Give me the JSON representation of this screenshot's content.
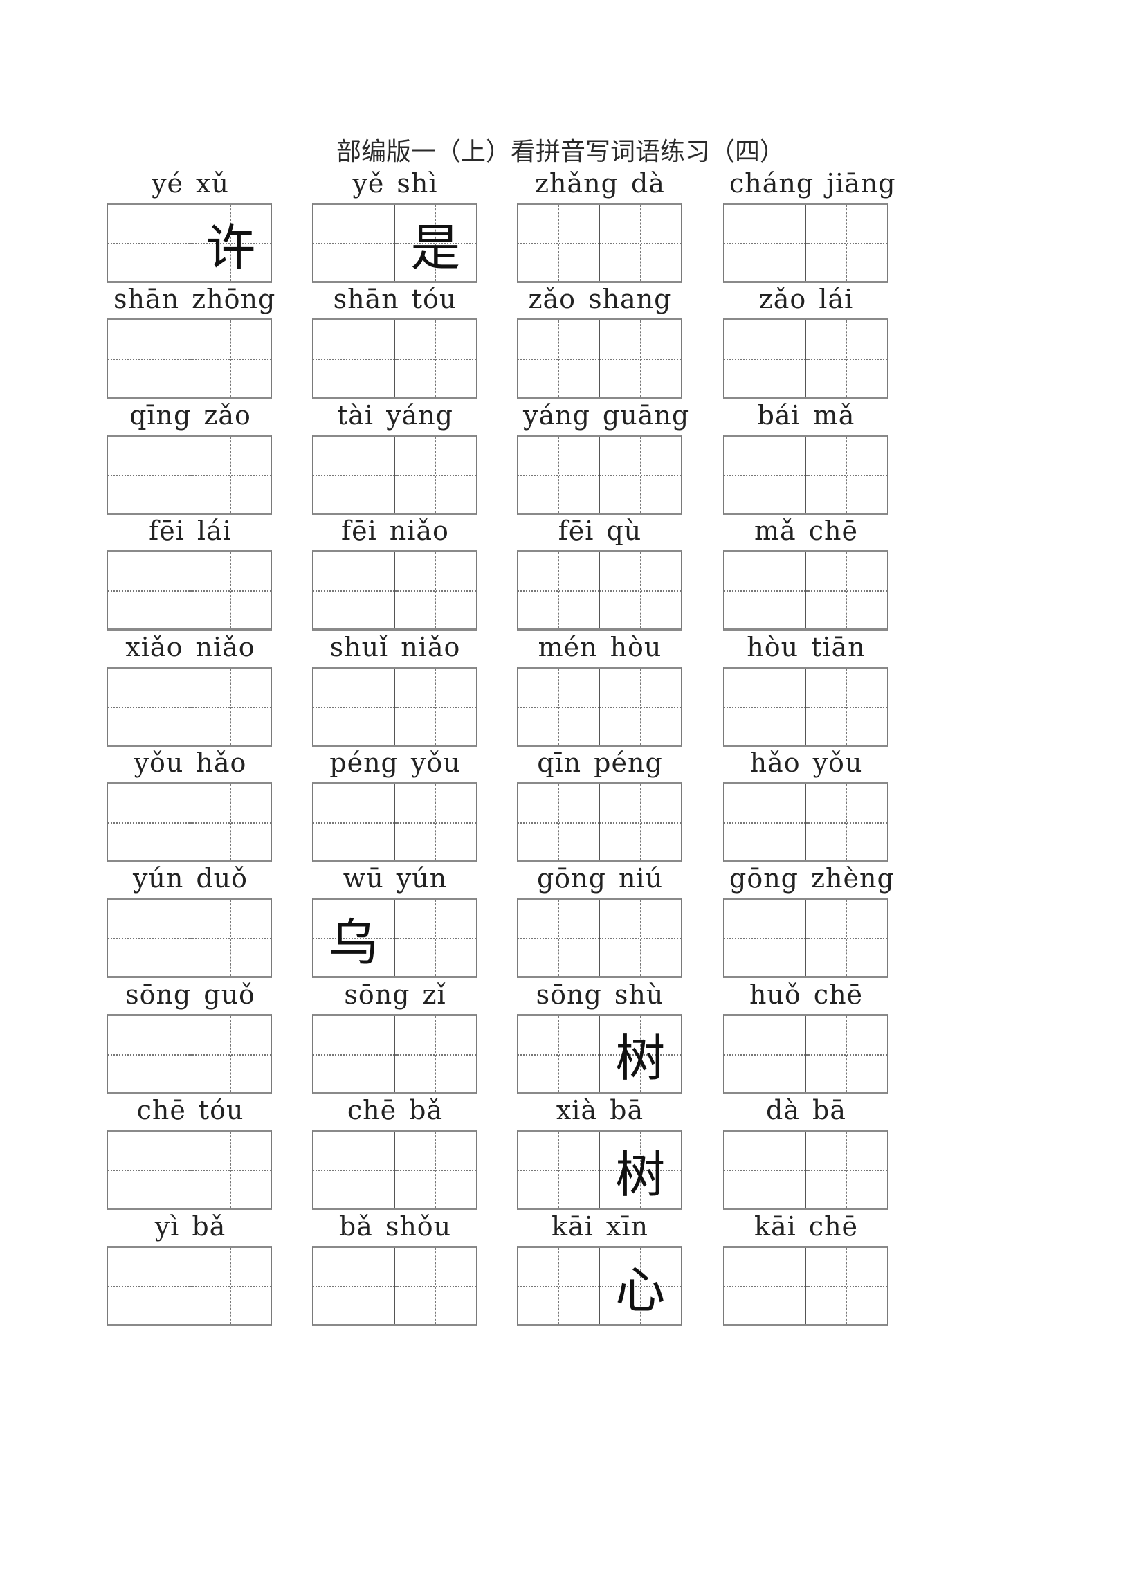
{
  "title": "部编版一（上）看拼音写词语练习（四）",
  "rows": [
    [
      {
        "pinyin": [
          "yé",
          "xǔ"
        ],
        "chars": [
          "",
          "许"
        ]
      },
      {
        "pinyin": [
          "yě",
          "shì"
        ],
        "chars": [
          "",
          "是"
        ]
      },
      {
        "pinyin": [
          "zhǎng",
          "dà"
        ],
        "chars": [
          "",
          ""
        ]
      },
      {
        "pinyin": [
          "cháng",
          "jiāng"
        ],
        "chars": [
          "",
          ""
        ]
      }
    ],
    [
      {
        "pinyin": [
          "shān",
          "zhōng"
        ],
        "chars": [
          "",
          ""
        ]
      },
      {
        "pinyin": [
          "shān",
          "tóu"
        ],
        "chars": [
          "",
          ""
        ]
      },
      {
        "pinyin": [
          "zǎo",
          "shang"
        ],
        "chars": [
          "",
          ""
        ]
      },
      {
        "pinyin": [
          "zǎo",
          "lái"
        ],
        "chars": [
          "",
          ""
        ]
      }
    ],
    [
      {
        "pinyin": [
          "qīng",
          "zǎo"
        ],
        "chars": [
          "",
          ""
        ]
      },
      {
        "pinyin": [
          "tài",
          "yáng"
        ],
        "chars": [
          "",
          ""
        ]
      },
      {
        "pinyin": [
          "yáng",
          "guāng"
        ],
        "chars": [
          "",
          ""
        ]
      },
      {
        "pinyin": [
          "bái",
          "mǎ"
        ],
        "chars": [
          "",
          ""
        ]
      }
    ],
    [
      {
        "pinyin": [
          "fēi",
          "lái"
        ],
        "chars": [
          "",
          ""
        ]
      },
      {
        "pinyin": [
          "fēi",
          "niǎo"
        ],
        "chars": [
          "",
          ""
        ]
      },
      {
        "pinyin": [
          "fēi",
          "qù"
        ],
        "chars": [
          "",
          ""
        ]
      },
      {
        "pinyin": [
          "mǎ",
          "chē"
        ],
        "chars": [
          "",
          ""
        ]
      }
    ],
    [
      {
        "pinyin": [
          "xiǎo",
          "niǎo"
        ],
        "chars": [
          "",
          ""
        ]
      },
      {
        "pinyin": [
          "shuǐ",
          "niǎo"
        ],
        "chars": [
          "",
          ""
        ]
      },
      {
        "pinyin": [
          "mén",
          "hòu"
        ],
        "chars": [
          "",
          ""
        ]
      },
      {
        "pinyin": [
          "hòu",
          "tiān"
        ],
        "chars": [
          "",
          ""
        ]
      }
    ],
    [
      {
        "pinyin": [
          "yǒu",
          "hǎo"
        ],
        "chars": [
          "",
          ""
        ]
      },
      {
        "pinyin": [
          "péng",
          "yǒu"
        ],
        "chars": [
          "",
          ""
        ]
      },
      {
        "pinyin": [
          "qīn",
          "péng"
        ],
        "chars": [
          "",
          ""
        ]
      },
      {
        "pinyin": [
          "hǎo",
          "yǒu"
        ],
        "chars": [
          "",
          ""
        ]
      }
    ],
    [
      {
        "pinyin": [
          "yún",
          "duǒ"
        ],
        "chars": [
          "",
          ""
        ]
      },
      {
        "pinyin": [
          "wū",
          "yún"
        ],
        "chars": [
          "乌",
          ""
        ]
      },
      {
        "pinyin": [
          "gōng",
          "niú"
        ],
        "chars": [
          "",
          ""
        ]
      },
      {
        "pinyin": [
          "gōng",
          "zhèng"
        ],
        "chars": [
          "",
          ""
        ]
      }
    ],
    [
      {
        "pinyin": [
          "sōng",
          "guǒ"
        ],
        "chars": [
          "",
          ""
        ]
      },
      {
        "pinyin": [
          "sōng",
          "zǐ"
        ],
        "chars": [
          "",
          ""
        ]
      },
      {
        "pinyin": [
          "sōng",
          "shù"
        ],
        "chars": [
          "",
          "树"
        ]
      },
      {
        "pinyin": [
          "huǒ",
          "chē"
        ],
        "chars": [
          "",
          ""
        ]
      }
    ],
    [
      {
        "pinyin": [
          "chē",
          "tóu"
        ],
        "chars": [
          "",
          ""
        ]
      },
      {
        "pinyin": [
          "chē",
          "bǎ"
        ],
        "chars": [
          "",
          ""
        ]
      },
      {
        "pinyin": [
          "xià",
          "bā"
        ],
        "chars": [
          "",
          "树"
        ]
      },
      {
        "pinyin": [
          "dà",
          "bā"
        ],
        "chars": [
          "",
          ""
        ]
      }
    ],
    [
      {
        "pinyin": [
          "yì",
          "bǎ"
        ],
        "chars": [
          "",
          ""
        ]
      },
      {
        "pinyin": [
          "bǎ",
          "shǒu"
        ],
        "chars": [
          "",
          ""
        ]
      },
      {
        "pinyin": [
          "kāi",
          "xīn"
        ],
        "chars": [
          "",
          "心"
        ]
      },
      {
        "pinyin": [
          "kāi",
          "chē"
        ],
        "chars": [
          "",
          ""
        ]
      }
    ]
  ]
}
